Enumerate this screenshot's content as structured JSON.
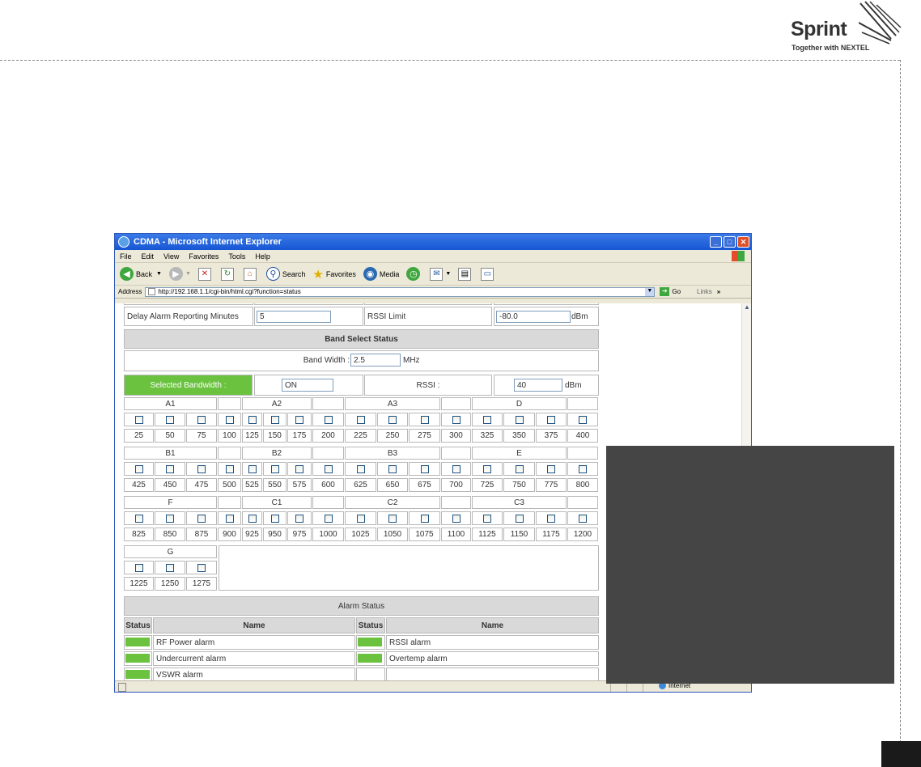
{
  "brand": {
    "name": "Sprint",
    "tagline": "Together with NEXTEL"
  },
  "window": {
    "title": "CDMA - Microsoft Internet Explorer",
    "menu": [
      "File",
      "Edit",
      "View",
      "Favorites",
      "Tools",
      "Help"
    ],
    "toolbar": {
      "back": "Back",
      "search": "Search",
      "favorites": "Favorites",
      "media": "Media"
    },
    "address_label": "Address",
    "url": "http://192.168.1.1/cgi-bin/html.cgi?function=status",
    "go": "Go",
    "links": "Links",
    "status_zone": "Internet"
  },
  "settings": {
    "delay_label": "Delay Alarm Reporting Minutes",
    "delay_value": "5",
    "rssi_limit_label": "RSSI Limit",
    "rssi_limit_value": "-80.0",
    "rssi_limit_unit": "dBm"
  },
  "band": {
    "section_title": "Band Select Status",
    "bandwidth_label": "Band Width :",
    "bandwidth_value": "2.5",
    "bandwidth_unit": "MHz",
    "selected_label": "Selected Bandwidth :",
    "selected_value": "ON",
    "rssi_label": "RSSI :",
    "rssi_value": "40",
    "rssi_unit": "dBm",
    "rows": [
      {
        "groups": [
          "A1",
          "A2",
          "A3",
          "D"
        ],
        "channels": [
          "25",
          "50",
          "75",
          "100",
          "125",
          "150",
          "175",
          "200",
          "225",
          "250",
          "275",
          "300",
          "325",
          "350",
          "375",
          "400"
        ]
      },
      {
        "groups": [
          "B1",
          "B2",
          "B3",
          "E"
        ],
        "channels": [
          "425",
          "450",
          "475",
          "500",
          "525",
          "550",
          "575",
          "600",
          "625",
          "650",
          "675",
          "700",
          "725",
          "750",
          "775",
          "800"
        ]
      },
      {
        "groups": [
          "F",
          "C1",
          "C2",
          "C3"
        ],
        "channels": [
          "825",
          "850",
          "875",
          "900",
          "925",
          "950",
          "975",
          "1000",
          "1025",
          "1050",
          "1075",
          "1100",
          "1125",
          "1150",
          "1175",
          "1200"
        ]
      },
      {
        "groups": [
          "G"
        ],
        "channels": [
          "1225",
          "1250",
          "1275"
        ]
      }
    ]
  },
  "alarms": {
    "section_title": "Alarm Status",
    "status_header": "Status",
    "name_header": "Name",
    "ok_color": "#6ac23f",
    "left": [
      "RF Power alarm",
      "Undercurrent alarm",
      "VSWR alarm"
    ],
    "right": [
      "RSSI alarm",
      "Overtemp alarm"
    ]
  }
}
